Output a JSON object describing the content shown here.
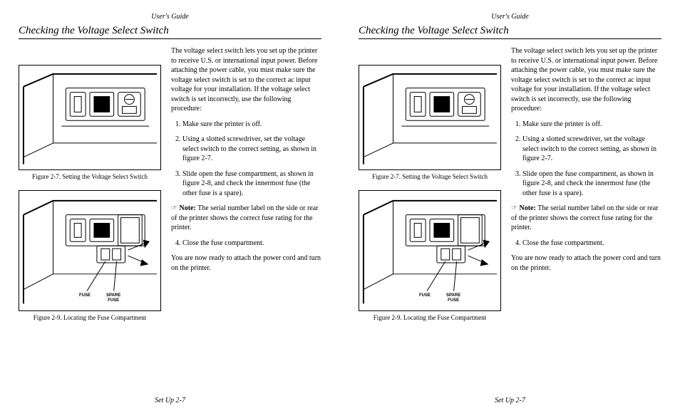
{
  "runningHead": "User's Guide",
  "sectionTitle": "Checking the Voltage Select Switch",
  "intro": "The voltage select switch lets you set up the printer to receive U.S. or international input power.  Before attaching the power cable, you must make sure the voltage select switch is set to the correct ac input voltage for your installation.  If the voltage select switch is set incorrectly, use the following procedure:",
  "steps": {
    "s1": "Make sure the printer is off.",
    "s2": "Using a slotted screwdriver, set the voltage select switch to the correct setting, as shown in figure 2-7.",
    "s3": "Slide open the fuse compartment, as shown in figure 2-8, and check the innermost fuse (the other fuse is a spare).",
    "s4": "Close the fuse compartment."
  },
  "noteIcon": "☞",
  "noteLabel": "Note:",
  "noteBody": "The serial number label on the side or rear of the printer shows the correct fuse rating for the printer.",
  "closing": "You are now ready to attach the power cord and turn on the printer.",
  "fig1Caption": "Figure 2-7.  Setting the Voltage Select Switch",
  "fig2Caption": "Figure 2-9.  Locating the Fuse Compartment",
  "fuseLabel": "FUSE",
  "spareFuseLabel1": "SPARE",
  "spareFuseLabel2": "FUSE",
  "footer": "Set Up  2-7"
}
